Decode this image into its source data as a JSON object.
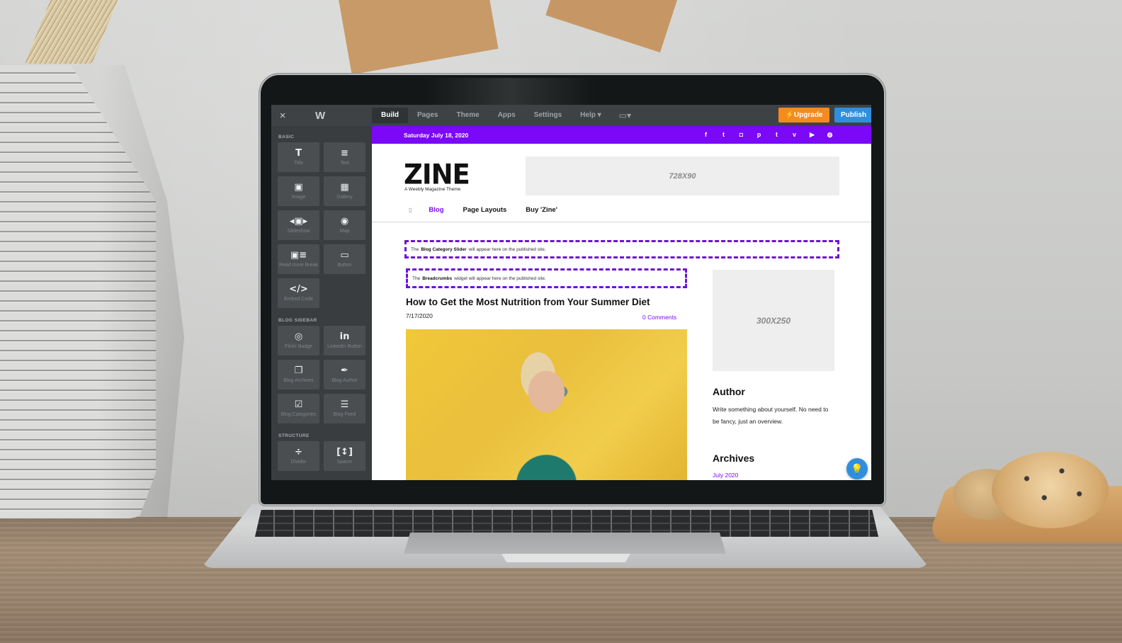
{
  "editor": {
    "close_icon": "×",
    "logo_glyph": "W",
    "tabs": [
      {
        "label": "Build",
        "active": true
      },
      {
        "label": "Pages",
        "active": false
      },
      {
        "label": "Theme",
        "active": false
      },
      {
        "label": "Apps",
        "active": false
      },
      {
        "label": "Settings",
        "active": false
      },
      {
        "label": "Help ▾",
        "active": false
      }
    ],
    "device_icon": "▭▾",
    "upgrade_label": "⚡Upgrade",
    "publish_label": "Publish"
  },
  "sidebar": {
    "sections": [
      {
        "title": "BASIC",
        "items": [
          {
            "label": "Title",
            "icon": "T"
          },
          {
            "label": "Text",
            "icon": "≡"
          },
          {
            "label": "Image",
            "icon": "▣"
          },
          {
            "label": "Gallery",
            "icon": "▦"
          },
          {
            "label": "Slideshow",
            "icon": "◂▣▸"
          },
          {
            "label": "Map",
            "icon": "◉"
          },
          {
            "label": "Read more Break",
            "icon": "▣≡"
          },
          {
            "label": "Button",
            "icon": "▭"
          },
          {
            "label": "Embed Code",
            "icon": "</>"
          }
        ]
      },
      {
        "title": "BLOG SIDEBAR",
        "items": [
          {
            "label": "Flickr Badge",
            "icon": "◎"
          },
          {
            "label": "LinkedIn Button",
            "icon": "in"
          },
          {
            "label": "Blog Archives",
            "icon": "❐"
          },
          {
            "label": "Blog Author",
            "icon": "✒"
          },
          {
            "label": "Blog Categories",
            "icon": "☑"
          },
          {
            "label": "Blog Feed",
            "icon": "☰"
          }
        ]
      },
      {
        "title": "STRUCTURE",
        "items": [
          {
            "label": "Divider",
            "icon": "÷"
          },
          {
            "label": "Spacer",
            "icon": "[↕]"
          }
        ]
      }
    ]
  },
  "site": {
    "date": "Saturday July 18, 2020",
    "social_icons": [
      {
        "name": "facebook",
        "glyph": "f"
      },
      {
        "name": "twitter",
        "glyph": "t"
      },
      {
        "name": "instagram",
        "glyph": "◘"
      },
      {
        "name": "pinterest",
        "glyph": "p"
      },
      {
        "name": "tumblr",
        "glyph": "t"
      },
      {
        "name": "vimeo",
        "glyph": "v"
      },
      {
        "name": "youtube",
        "glyph": "▶"
      },
      {
        "name": "dribbble",
        "glyph": "◍"
      }
    ],
    "logo": "ZINE",
    "tagline": "A Weebly Magazine Theme",
    "ad_top": "728X90",
    "nav": {
      "home_icon": "▯",
      "items": [
        {
          "label": "Blog",
          "active": true
        },
        {
          "label": "Page Layouts",
          "active": false
        },
        {
          "label": "Buy 'Zine'",
          "active": false
        }
      ]
    },
    "placeholders": {
      "slider": {
        "pre": "The",
        "bold": "Blog Category Slider",
        "post": "will appear here on the published site."
      },
      "breadcrumbs": {
        "pre": "The",
        "bold": "Breadcrumbs",
        "post": "widget will appear here on the published site."
      }
    },
    "post": {
      "title": "How to Get the Most Nutrition from Your Summer Diet",
      "date": "7/17/2020",
      "comments": "0 Comments"
    },
    "ad_side": "300X250",
    "author": {
      "heading": "Author",
      "body": "Write something about yourself. No need to be fancy, just an overview."
    },
    "archives": {
      "heading": "Archives",
      "links": [
        "July 2020"
      ]
    },
    "help_icon": "💡"
  },
  "colors": {
    "brand_purple": "#7b08f7",
    "upgrade_orange": "#f58a1f",
    "publish_blue": "#2f8fde",
    "editor_bg": "#3a3d40"
  }
}
